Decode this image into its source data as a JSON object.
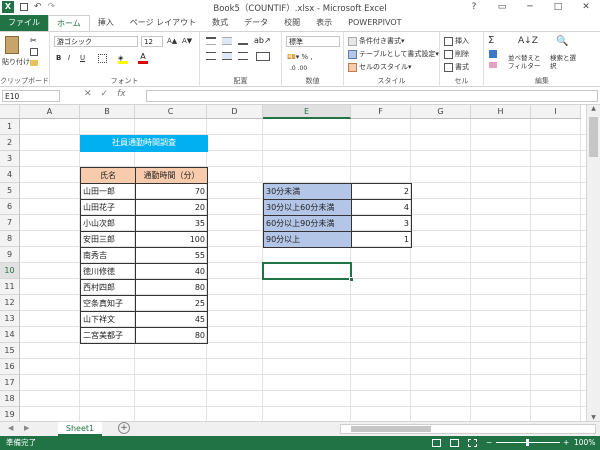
{
  "window": {
    "title": "Book5（COUNTIF）.xlsx - Microsoft Excel",
    "controls": [
      "?",
      "▭",
      "─",
      "□",
      "✕"
    ]
  },
  "qat": {
    "logo": "X",
    "undo": "↶",
    "redo": "↷"
  },
  "tabs": [
    "ファイル",
    "ホーム",
    "挿入",
    "ページ レイアウト",
    "数式",
    "データ",
    "校閲",
    "表示",
    "POWERPIVOT"
  ],
  "ribbon": {
    "clipboard": {
      "paste": "貼り付け",
      "label": "クリップボード"
    },
    "font": {
      "name": "游ゴシック",
      "size": "12",
      "bold": "B",
      "italic": "I",
      "underline": "U",
      "label": "フォント"
    },
    "alignment": {
      "label": "配置"
    },
    "number": {
      "format": "標準",
      "label": "数値"
    },
    "styles": {
      "conditional": "条件付き書式",
      "table": "テーブルとして書式設定",
      "cell": "セルのスタイル",
      "label": "スタイル"
    },
    "cells": {
      "insert": "挿入",
      "delete": "削除",
      "format": "書式",
      "label": "セル"
    },
    "editing": {
      "sum": "Σ",
      "sort": "並べ替えとフィルター",
      "find": "検索と選択",
      "label": "編集"
    }
  },
  "formula_bar": {
    "namebox": "E10",
    "fx": "fx",
    "content": ""
  },
  "columns": [
    "A",
    "B",
    "C",
    "D",
    "E",
    "F",
    "G",
    "H",
    "I"
  ],
  "rows": [
    "1",
    "2",
    "3",
    "4",
    "5",
    "6",
    "7",
    "8",
    "9",
    "10",
    "11",
    "12",
    "13",
    "14",
    "15",
    "16",
    "17",
    "18",
    "19"
  ],
  "selected": {
    "col": "E",
    "row": "10"
  },
  "sheet": {
    "title": "社員通勤時間調査",
    "headers": {
      "name": "氏名",
      "time": "通勤時間（分）"
    },
    "employees": [
      {
        "name": "山田一郎",
        "time": "70"
      },
      {
        "name": "山田花子",
        "time": "20"
      },
      {
        "name": "小山次郎",
        "time": "35"
      },
      {
        "name": "安田三郎",
        "time": "100"
      },
      {
        "name": "南秀吉",
        "time": "55"
      },
      {
        "name": "徳川修徳",
        "time": "40"
      },
      {
        "name": "西村四郎",
        "time": "80"
      },
      {
        "name": "空条真知子",
        "time": "25"
      },
      {
        "name": "山下祥文",
        "time": "45"
      },
      {
        "name": "二宮美都子",
        "time": "80"
      }
    ],
    "summary": [
      {
        "label": "30分未満",
        "count": "2"
      },
      {
        "label": "30分以上60分未満",
        "count": "4"
      },
      {
        "label": "60分以上90分未満",
        "count": "3"
      },
      {
        "label": "90分以上",
        "count": "1"
      }
    ]
  },
  "sheets": [
    "Sheet1"
  ],
  "add_sheet": "+",
  "status": {
    "ready": "準備完了",
    "zoom": "100%"
  },
  "colors": {
    "accent": "#217346",
    "title_fill": "#00B0F0",
    "header_fill": "#F8CBAD",
    "summary_fill": "#B4C6E7"
  }
}
